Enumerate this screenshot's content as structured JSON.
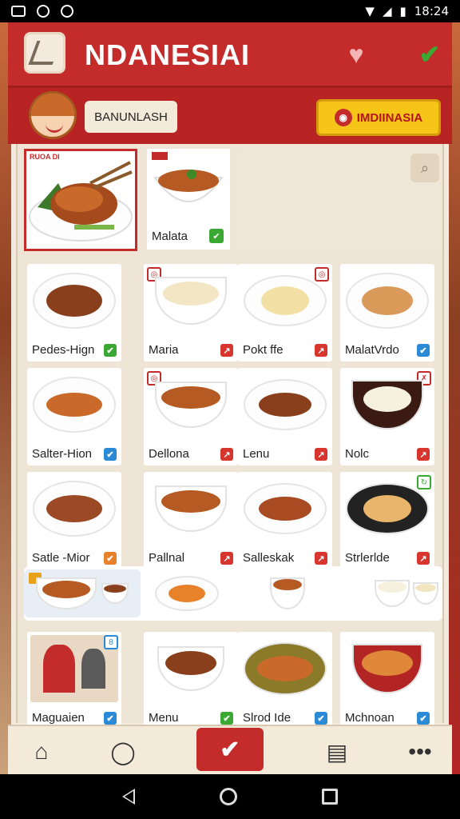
{
  "status_bar": {
    "time": "18:24"
  },
  "header": {
    "title": "NDANESIAI"
  },
  "subheader": {
    "user_label": "BANUNLASH",
    "region_label": "IMDIINASIA"
  },
  "featured": {
    "badge": "RUOA DI",
    "second_label": "Malata"
  },
  "grid": [
    {
      "label": "Pedes-Hign",
      "mark": "green"
    },
    {
      "label": "Maria",
      "mark": "red"
    },
    {
      "label": "Pokt ffe",
      "mark": "red"
    },
    {
      "label": "MalatVrdo",
      "mark": "blue"
    },
    {
      "label": "Salter-Hion",
      "mark": "blue"
    },
    {
      "label": "Dellona",
      "mark": "red"
    },
    {
      "label": "Lenu",
      "mark": "red"
    },
    {
      "label": "Nolc",
      "mark": "red"
    },
    {
      "label": "Satle -Mior",
      "mark": "orange"
    },
    {
      "label": "Pallnal",
      "mark": "red"
    },
    {
      "label": "Salleskak",
      "mark": "red"
    },
    {
      "label": "Strlerlde",
      "mark": "red"
    }
  ],
  "bottom_grid": [
    {
      "label": "Maguaien",
      "mark": "blue"
    },
    {
      "label": "Menu",
      "mark": "green"
    },
    {
      "label": "Slrod Ide",
      "mark": "blue"
    },
    {
      "label": "Mchnoan",
      "mark": "blue"
    }
  ],
  "nav": {
    "items": [
      "home-icon",
      "chat-icon",
      "check-icon",
      "clipboard-icon",
      "more-icon"
    ]
  }
}
